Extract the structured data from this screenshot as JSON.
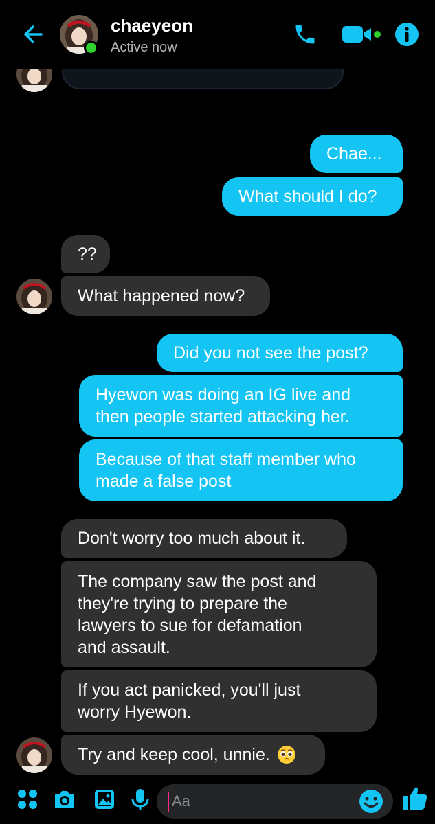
{
  "header": {
    "name": "chaeyeon",
    "status": "Active now",
    "accent": "#14c5f3",
    "icons": [
      "back-arrow-icon",
      "phone-icon",
      "video-camera-icon",
      "info-icon"
    ]
  },
  "messages": [
    {
      "side": "outgoing",
      "text": "Chae..."
    },
    {
      "side": "outgoing",
      "text": "What should I do?"
    },
    {
      "side": "incoming",
      "text": "??"
    },
    {
      "side": "incoming",
      "text": "What happened now?"
    },
    {
      "side": "outgoing",
      "text": "Did you not see the post?"
    },
    {
      "side": "outgoing",
      "text": "Hyewon was doing an IG live and\nthen people started attacking her."
    },
    {
      "side": "outgoing",
      "text": "Because of that staff member who\nmade a false post"
    },
    {
      "side": "incoming",
      "text": "Don't worry too much about it."
    },
    {
      "side": "incoming",
      "text": "The company saw the post and\nthey're trying to prepare the\nlawyers to sue for defamation\nand assault."
    },
    {
      "side": "incoming",
      "text": "If you act panicked, you'll just\nworry Hyewon."
    },
    {
      "side": "incoming",
      "text": "Try and keep cool, unnie.",
      "emoji": "pleading-face-emoji"
    }
  ],
  "composer": {
    "placeholder": "Aa",
    "icons": [
      "more-apps-icon",
      "camera-icon",
      "gallery-icon",
      "microphone-icon",
      "emoji-icon",
      "thumbs-up-icon"
    ]
  },
  "colors": {
    "outgoing_bubble": "#14c5f3",
    "incoming_bubble": "#303030",
    "background": "#000000",
    "online": "#2fd12f"
  }
}
